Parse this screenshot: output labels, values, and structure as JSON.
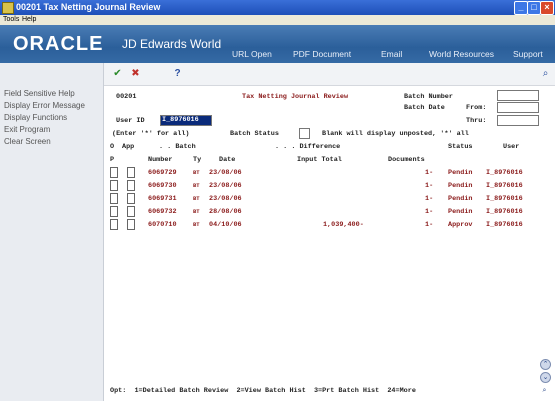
{
  "window": {
    "title": "00201   Tax Netting Journal Review",
    "controls": [
      "minimize",
      "maximize",
      "close"
    ]
  },
  "menu": {
    "items": [
      "Tools",
      "Help"
    ]
  },
  "banner": {
    "logo": "ORACLE",
    "product": "JD Edwards World",
    "nav": [
      "URL Open",
      "PDF Document",
      "Email",
      "World Resources",
      "Support"
    ]
  },
  "sidebar": {
    "items": [
      "Field Sensitive Help",
      "Display Error Message",
      "Display Functions",
      "Exit Program",
      "Clear Screen"
    ]
  },
  "toolbar": {
    "icons": [
      "check-icon",
      "cancel-icon",
      "help-icon",
      "search-icon"
    ]
  },
  "screen": {
    "program_id": "00201",
    "title": "Tax Netting Journal Review",
    "batch_number_label": "Batch Number",
    "batch_number": "",
    "batch_date_label": "Batch Date",
    "from_label": "From:",
    "from": "",
    "thru_label": "Thru:",
    "thru": "",
    "user_id_label": "User ID",
    "user_id": "I_8976016",
    "enter_hint": "(Enter '*' for all)",
    "batch_status_label": "Batch Status",
    "batch_status": "",
    "batch_status_hint": "Blank will display unposted, '*' all",
    "headers": {
      "row1": {
        "o": "O",
        "app": "App",
        "batch": ". . Batch",
        "difference": ". . . Difference"
      },
      "row2": {
        "p": "P",
        "number": "Number",
        "ty": "Ty",
        "date": "Date",
        "input_total": "Input Total",
        "documents": "Documents",
        "status": "Status",
        "user": "User"
      }
    },
    "rows": [
      {
        "number": "6069729",
        "ty": "BT",
        "date": "23/08/06",
        "input_total": "",
        "documents": "1-",
        "status": "Pendin",
        "user": "I_8976016"
      },
      {
        "number": "6069730",
        "ty": "BT",
        "date": "23/08/06",
        "input_total": "",
        "documents": "1-",
        "status": "Pendin",
        "user": "I_8976016"
      },
      {
        "number": "6069731",
        "ty": "BT",
        "date": "23/08/06",
        "input_total": "",
        "documents": "1-",
        "status": "Pendin",
        "user": "I_8976016"
      },
      {
        "number": "6069732",
        "ty": "BT",
        "date": "28/08/06",
        "input_total": "",
        "documents": "1-",
        "status": "Pendin",
        "user": "I_8976016"
      },
      {
        "number": "6070710",
        "ty": "BT",
        "date": "04/10/06",
        "input_total": "1,039,400-",
        "documents": "1-",
        "status": "Approv",
        "user": "I_8976016"
      }
    ],
    "options": "Opt:  1=Detailed Batch Review  2=View Batch Hist  3=Prt Batch Hist  24=More"
  }
}
